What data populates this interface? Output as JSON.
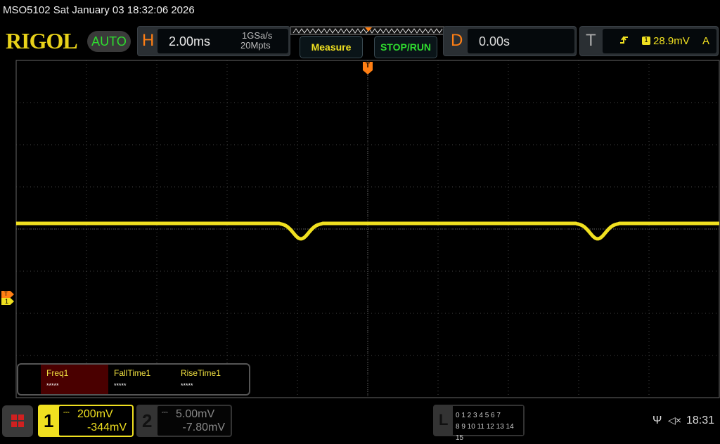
{
  "title": "MSO5102  Sat January 03 18:32:06 2026",
  "logo": "RIGOL",
  "mode": "AUTO",
  "horizontal": {
    "label": "H",
    "timebase": "2.00ms",
    "sample_rate": "1GSa/s",
    "memory": "20Mpts"
  },
  "buttons": {
    "measure": "Measure",
    "stop_run": "STOP/RUN"
  },
  "delay": {
    "label": "D",
    "value": "0.00s"
  },
  "trigger": {
    "label": "T",
    "source": "1",
    "level": "28.9mV",
    "mode": "A",
    "edge_icon": "rising-edge-icon"
  },
  "measurements": [
    {
      "name": "Freq1",
      "value": "*****"
    },
    {
      "name": "FallTime1",
      "value": "*****"
    },
    {
      "name": "RiseTime1",
      "value": "*****"
    }
  ],
  "channels": [
    {
      "num": "1",
      "scale": "200mV",
      "offset": "-344mV",
      "color": "#f0e020"
    },
    {
      "num": "2",
      "scale": "5.00mV",
      "offset": "-7.80mV",
      "color": "#888888"
    }
  ],
  "logic": {
    "label": "L",
    "row1": "0 1 2 3  4 5 6 7",
    "row2": "8 9 10 11 12 13 14 15"
  },
  "status": {
    "time": "18:31",
    "usb_icon": "usb-icon",
    "sound_icon": "muted-speaker-icon"
  },
  "markers": {
    "trigger_pos": "T",
    "ch1_marker": "1",
    "trigger_level_marker": "T"
  },
  "colors": {
    "trace": "#f0e020",
    "accent": "#ff7f14",
    "green": "#2fdc2f"
  }
}
